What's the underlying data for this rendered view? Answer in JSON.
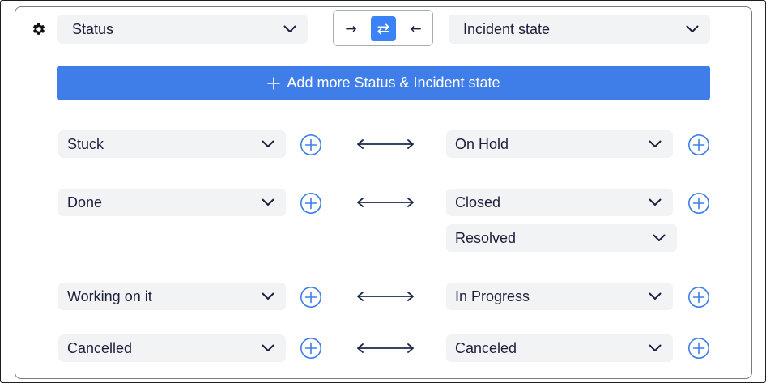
{
  "header": {
    "source_select": "Status",
    "target_select": "Incident state",
    "direction_buttons": [
      {
        "name": "one-way-right",
        "glyph": "→",
        "active": false
      },
      {
        "name": "two-way",
        "glyph": "⇄",
        "active": true
      },
      {
        "name": "one-way-left",
        "glyph": "←",
        "active": false
      }
    ]
  },
  "add_button": {
    "label": "Add more Status & Incident state"
  },
  "mappings": [
    {
      "left": "Stuck",
      "right": [
        "On Hold"
      ]
    },
    {
      "left": "Done",
      "right": [
        "Closed",
        "Resolved"
      ]
    },
    {
      "left": "Working on it",
      "right": [
        "In Progress"
      ]
    },
    {
      "left": "Cancelled",
      "right": [
        "Canceled"
      ]
    }
  ],
  "colors": {
    "accent": "#3f7ee8",
    "active_direction": "#3b82f6",
    "select_bg": "#f2f3f5",
    "text": "#1c1f3b",
    "arrow": "#1c2a4a"
  },
  "icons": {
    "settings": "gear-icon",
    "dropdown": "chevron-down-icon",
    "add_row": "plus-circle-icon",
    "mapping": "double-arrow-icon"
  }
}
